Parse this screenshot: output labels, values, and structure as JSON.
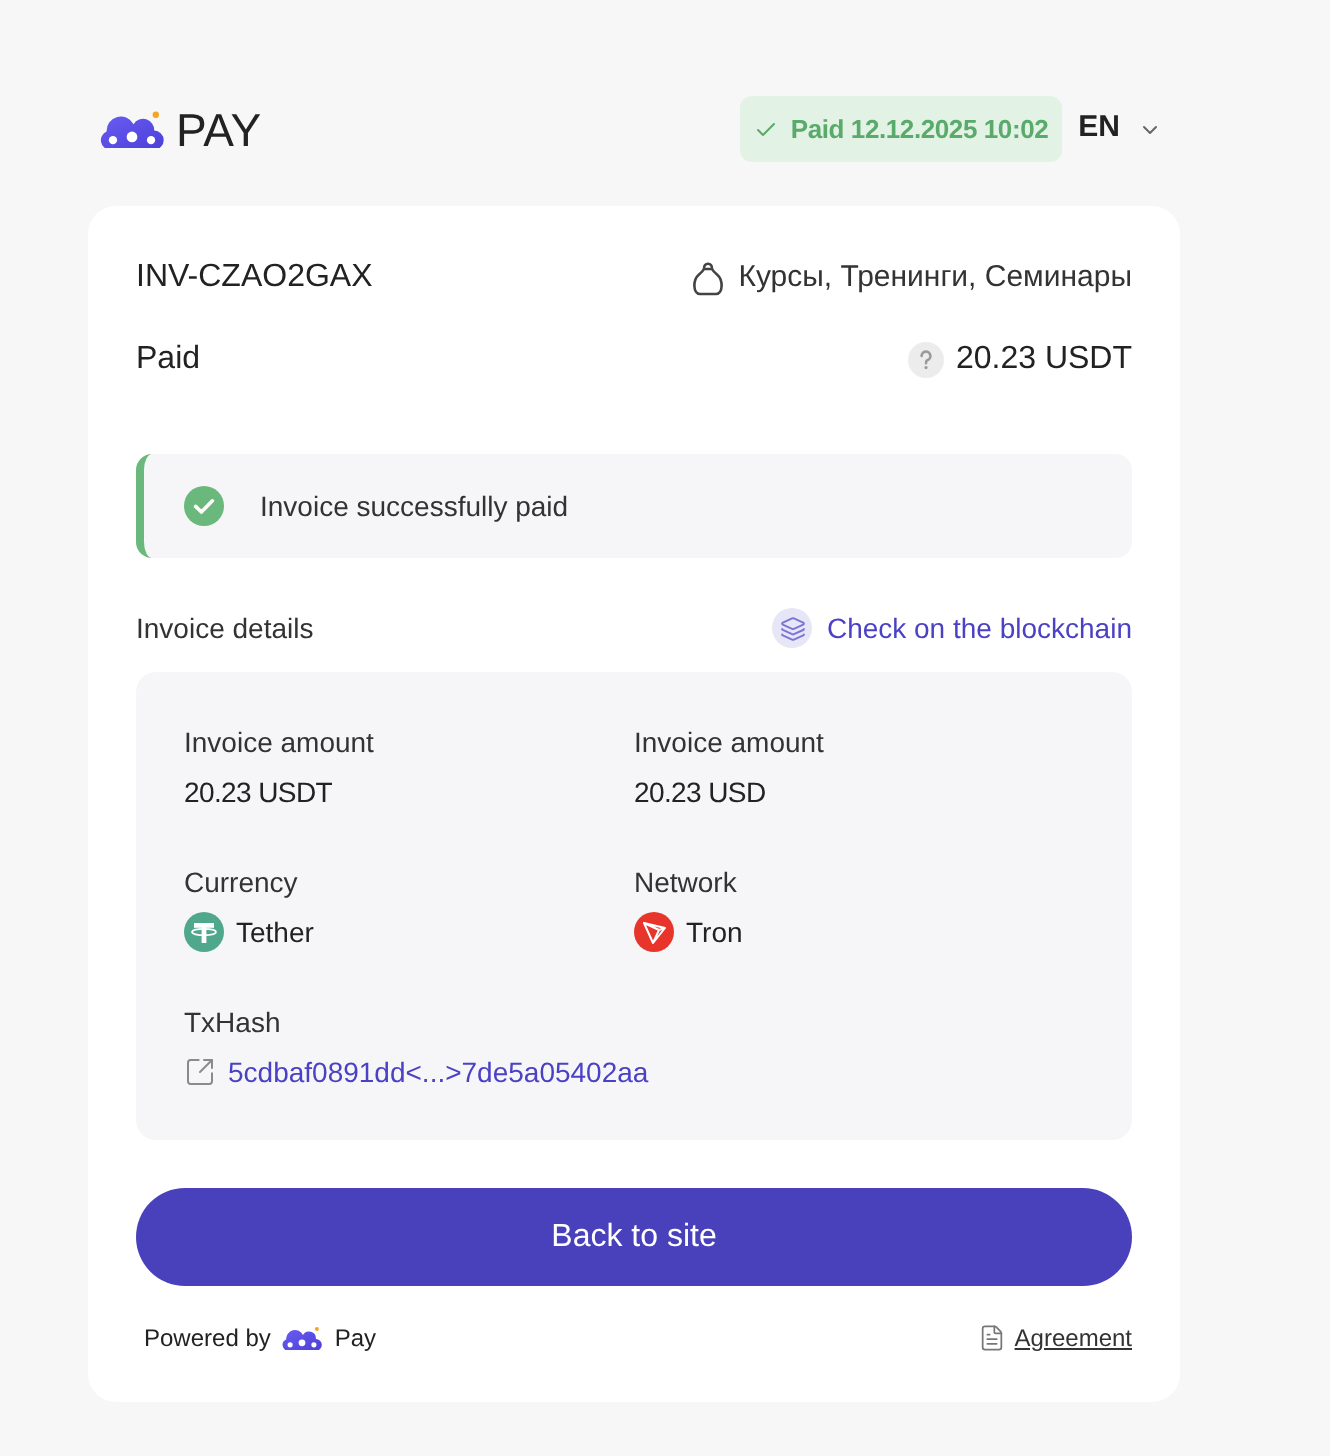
{
  "header": {
    "logo_text": "PAY",
    "status_badge": {
      "text": "Paid 12.12.2025 10:02",
      "kind": "success"
    },
    "language": "EN"
  },
  "invoice": {
    "id": "INV-CZAO2GAX",
    "category": "Курсы, Тренинги, Семинары",
    "status": "Paid",
    "amount": "20.23 USDT"
  },
  "alert": {
    "kind": "success",
    "text": "Invoice successfully paid"
  },
  "details": {
    "title": "Invoice details",
    "blockchain_link": "Check on the blockchain",
    "fields": [
      {
        "label": "Invoice amount",
        "value": "20.23 USDT",
        "kind": "amount"
      },
      {
        "label": "Invoice amount",
        "value": "20.23 USD",
        "kind": "amount"
      },
      {
        "label": "Currency",
        "value": "Tether",
        "kind": "currency"
      },
      {
        "label": "Network",
        "value": "Tron",
        "kind": "network"
      },
      {
        "label": "TxHash",
        "value": "5cdbaf0891dd<...>7de5a05402aa",
        "kind": "hash"
      }
    ]
  },
  "button": "Back to site",
  "footer": {
    "powered_by": "Powered by",
    "brand": "Pay",
    "agreement": "Agreement"
  }
}
